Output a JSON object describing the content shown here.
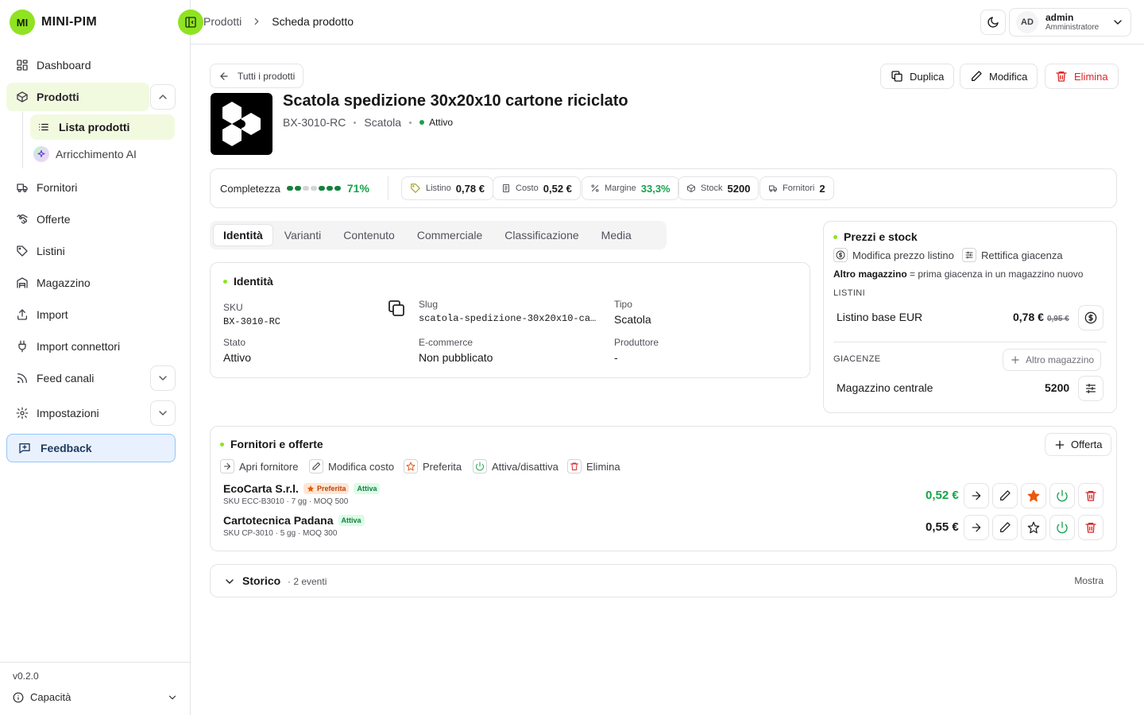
{
  "brand": {
    "logo": "MI",
    "name": "MINI-PIM"
  },
  "sidebar": {
    "items": [
      {
        "label": "Dashboard"
      },
      {
        "label": "Prodotti"
      },
      {
        "label": "Fornitori"
      },
      {
        "label": "Offerte"
      },
      {
        "label": "Listini"
      },
      {
        "label": "Magazzino"
      },
      {
        "label": "Import"
      },
      {
        "label": "Import connettori"
      },
      {
        "label": "Feed canali"
      },
      {
        "label": "Impostazioni"
      }
    ],
    "sub_items": [
      {
        "label": "Lista prodotti"
      },
      {
        "label": "Arricchimento AI"
      }
    ],
    "feedback": "Feedback",
    "version": "v0.2.0",
    "capacity": "Capacità"
  },
  "header": {
    "breadcrumb": [
      "Prodotti",
      "Scheda prodotto"
    ],
    "user": {
      "initials": "AD",
      "name": "admin",
      "role": "Amministratore"
    }
  },
  "product": {
    "back": "Tutti i prodotti",
    "actions": {
      "duplicate": "Duplica",
      "edit": "Modifica",
      "delete": "Elimina"
    },
    "title": "Scatola spedizione 30x20x10 cartone riciclato",
    "sku": "BX-3010-RC",
    "type": "Scatola",
    "status": "Attivo"
  },
  "stats": {
    "completeness_label": "Completezza",
    "completeness": "71%",
    "completeness_fraction": 0.71,
    "list_label": "Listino",
    "list_value": "0,78 €",
    "cost_label": "Costo",
    "cost_value": "0,52 €",
    "margin_label": "Margine",
    "margin_value": "33,3%",
    "stock_label": "Stock",
    "stock_value": "5200",
    "suppliers_label": "Fornitori",
    "suppliers_value": "2"
  },
  "tabs": [
    "Identità",
    "Varianti",
    "Contenuto",
    "Commerciale",
    "Classificazione",
    "Media"
  ],
  "identity": {
    "title": "Identità",
    "sku_label": "SKU",
    "sku": "BX-3010-RC",
    "slug_label": "Slug",
    "slug": "scatola-spedizione-30x20x10-ca…",
    "type_label": "Tipo",
    "type": "Scatola",
    "status_label": "Stato",
    "status": "Attivo",
    "ecom_label": "E-commerce",
    "ecom": "Non pubblicato",
    "producer_label": "Produttore",
    "producer": "-"
  },
  "prices": {
    "title": "Prezzi e stock",
    "edit_price": "Modifica prezzo listino",
    "adjust_stock": "Rettifica giacenza",
    "hint_bold": "Altro magazzino",
    "hint_rest": " = prima giacenza in un magazzino nuovo",
    "lists_label": "LISTINI",
    "list_name": "Listino base EUR",
    "list_price": "0,78 €",
    "list_old": "0,95 €",
    "stock_label": "GIACENZE",
    "other_wh": "Altro magazzino",
    "wh_name": "Magazzino centrale",
    "wh_qty": "5200"
  },
  "suppliers": {
    "title": "Fornitori e offerte",
    "add_offer": "Offerta",
    "legend": [
      "Apri fornitore",
      "Modifica costo",
      "Preferita",
      "Attiva/disattiva",
      "Elimina"
    ],
    "rows": [
      {
        "name": "EcoCarta S.r.l.",
        "preferred": "Preferita",
        "active": "Attiva",
        "sub": "SKU ECC-B3010 · 7 gg · MOQ 500",
        "price": "0,52 €"
      },
      {
        "name": "Cartotecnica Padana",
        "active": "Attiva",
        "sub": "SKU CP-3010 · 5 gg · MOQ 300",
        "price": "0,55 €"
      }
    ]
  },
  "history": {
    "title": "Storico",
    "count": "· 2 eventi",
    "show": "Mostra"
  }
}
